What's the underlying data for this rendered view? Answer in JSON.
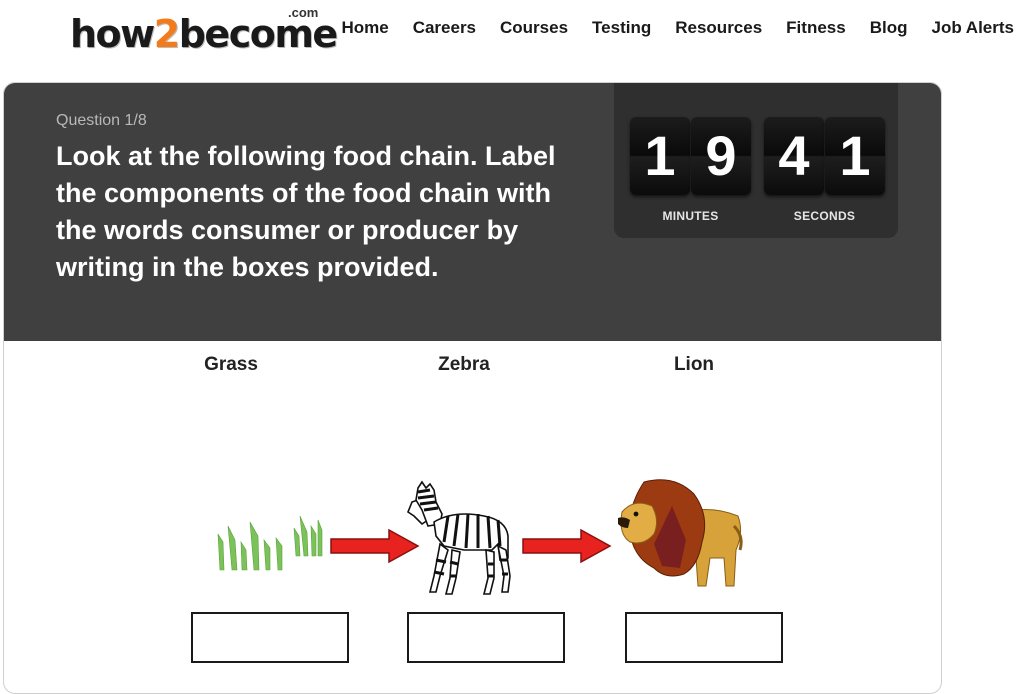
{
  "header": {
    "logo_main_left": "how",
    "logo_main_accent": "2",
    "logo_main_right": "become",
    "logo_com": ".com",
    "nav": [
      "Home",
      "Careers",
      "Courses",
      "Testing",
      "Resources",
      "Fitness",
      "Blog",
      "Job Alerts"
    ]
  },
  "question": {
    "number": "Question 1/8",
    "text": "Look at the following food chain. Label the components of the food chain with the words consumer or producer by writing in the boxes provided."
  },
  "timer": {
    "minutes_digits": [
      "1",
      "9"
    ],
    "seconds_digits": [
      "4",
      "1"
    ],
    "minutes_label": "MINUTES",
    "seconds_label": "SECONDS"
  },
  "food_chain": {
    "labels": [
      "Grass",
      "Zebra",
      "Lion"
    ],
    "answers": [
      "",
      "",
      ""
    ],
    "icons": [
      "grass-icon",
      "arrow-right-icon",
      "zebra-icon",
      "arrow-right-icon",
      "lion-icon"
    ]
  },
  "colors": {
    "header_bg": "#404040",
    "timer_bg": "#2f2f2f",
    "logo_accent": "#f27b1c",
    "arrow_red": "#e8231f"
  }
}
